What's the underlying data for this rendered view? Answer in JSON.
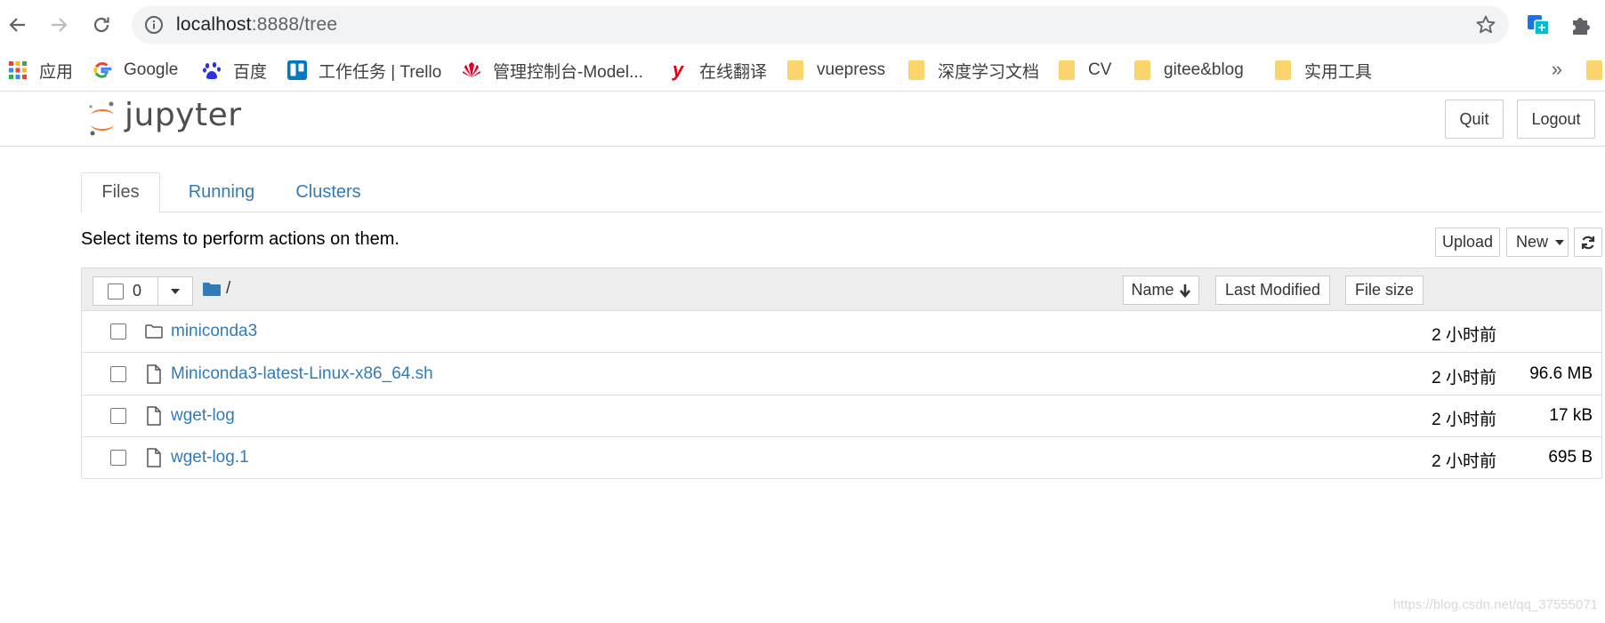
{
  "browser": {
    "url_host": "localhost",
    "url_rest": ":8888/tree",
    "bookmarks": [
      {
        "label": "应用",
        "icon": "apps-grid-icon"
      },
      {
        "label": "Google",
        "icon": "google-icon"
      },
      {
        "label": "百度",
        "icon": "baidu-icon"
      },
      {
        "label": "工作任务 | Trello",
        "icon": "trello-icon"
      },
      {
        "label": "管理控制台-Model...",
        "icon": "huawei-icon"
      },
      {
        "label": "在线翻译",
        "icon": "youdao-icon"
      },
      {
        "label": "vuepress",
        "icon": "folder-icon"
      },
      {
        "label": "深度学习文档",
        "icon": "folder-icon"
      },
      {
        "label": "CV",
        "icon": "folder-icon"
      },
      {
        "label": "gitee&blog",
        "icon": "folder-icon"
      },
      {
        "label": "实用工具",
        "icon": "folder-icon"
      }
    ],
    "more": "»"
  },
  "header": {
    "wordmark": "jupyter",
    "quit_label": "Quit",
    "logout_label": "Logout"
  },
  "tabs": [
    {
      "label": "Files",
      "active": true
    },
    {
      "label": "Running",
      "active": false
    },
    {
      "label": "Clusters",
      "active": false
    }
  ],
  "hint": "Select items to perform actions on them.",
  "toolbar": {
    "upload_label": "Upload",
    "new_label": "New"
  },
  "list": {
    "selected_count": "0",
    "breadcrumb": "/",
    "col_name": "Name",
    "col_modified": "Last Modified",
    "col_size": "File size",
    "rows": [
      {
        "name": "miniconda3",
        "type": "folder",
        "modified": "2 小时前",
        "size": ""
      },
      {
        "name": "Miniconda3-latest-Linux-x86_64.sh",
        "type": "file",
        "modified": "2 小时前",
        "size": "96.6 MB"
      },
      {
        "name": "wget-log",
        "type": "file",
        "modified": "2 小时前",
        "size": "17 kB"
      },
      {
        "name": "wget-log.1",
        "type": "file",
        "modified": "2 小时前",
        "size": "695 B"
      }
    ]
  },
  "watermark": "https://blog.csdn.net/qq_37555071",
  "colors": {
    "link": "#337ab7",
    "jupyter_orange": "#f37726",
    "header_bg": "#eeeeee"
  }
}
